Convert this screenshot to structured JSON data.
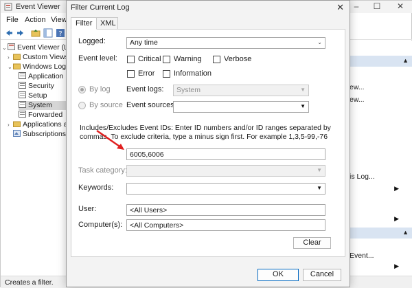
{
  "event_viewer": {
    "title": "Event Viewer",
    "window_controls": {
      "minimize": "–",
      "maximize": "☐",
      "close": "✕"
    },
    "menu": [
      "File",
      "Action",
      "View"
    ],
    "tree": [
      {
        "label": "Event Viewer (Loca",
        "icon": "event-viewer-icon"
      },
      {
        "label": "Custom Views",
        "icon": "folder-icon"
      },
      {
        "label": "Windows Logs",
        "icon": "folder-icon"
      },
      {
        "label": "Application",
        "icon": "log-icon"
      },
      {
        "label": "Security",
        "icon": "log-icon"
      },
      {
        "label": "Setup",
        "icon": "log-icon"
      },
      {
        "label": "System",
        "icon": "log-icon"
      },
      {
        "label": "Forwarded",
        "icon": "log-icon"
      },
      {
        "label": "Applications ar",
        "icon": "folder-icon"
      },
      {
        "label": "Subscriptions",
        "icon": "subscriptions-icon"
      }
    ],
    "actions_partial": [
      "ew...",
      "ew...",
      "is Log...",
      "Event..."
    ],
    "status_text": "Creates a filter.",
    "accent_color": "#d9e4f2"
  },
  "dialog": {
    "title": "Filter Current Log",
    "close": "✕",
    "tabs": [
      "Filter",
      "XML"
    ],
    "logged": {
      "label": "Logged:",
      "value": "Any time"
    },
    "event_level": {
      "label": "Event level:",
      "critical": "Critical",
      "warning": "Warning",
      "verbose": "Verbose",
      "error": "Error",
      "information": "Information"
    },
    "by_log": "By log",
    "by_source": "By source",
    "event_logs": {
      "label": "Event logs:",
      "value": "System"
    },
    "event_sources": {
      "label": "Event sources:",
      "value": ""
    },
    "ids_description": "Includes/Excludes Event IDs: Enter ID numbers and/or ID ranges separated by commas. To exclude criteria, type a minus sign first. For example 1,3,5-99,-76",
    "event_ids_value": "6005,6006",
    "task_category": {
      "label": "Task category:",
      "value": ""
    },
    "keywords": {
      "label": "Keywords:",
      "value": ""
    },
    "user": {
      "label": "User:",
      "value": "<All Users>"
    },
    "computers": {
      "label": "Computer(s):",
      "value": "<All Computers>"
    },
    "clear_button": "Clear",
    "ok_button": "OK",
    "cancel_button": "Cancel",
    "annotation_arrow_color": "#e02020"
  }
}
